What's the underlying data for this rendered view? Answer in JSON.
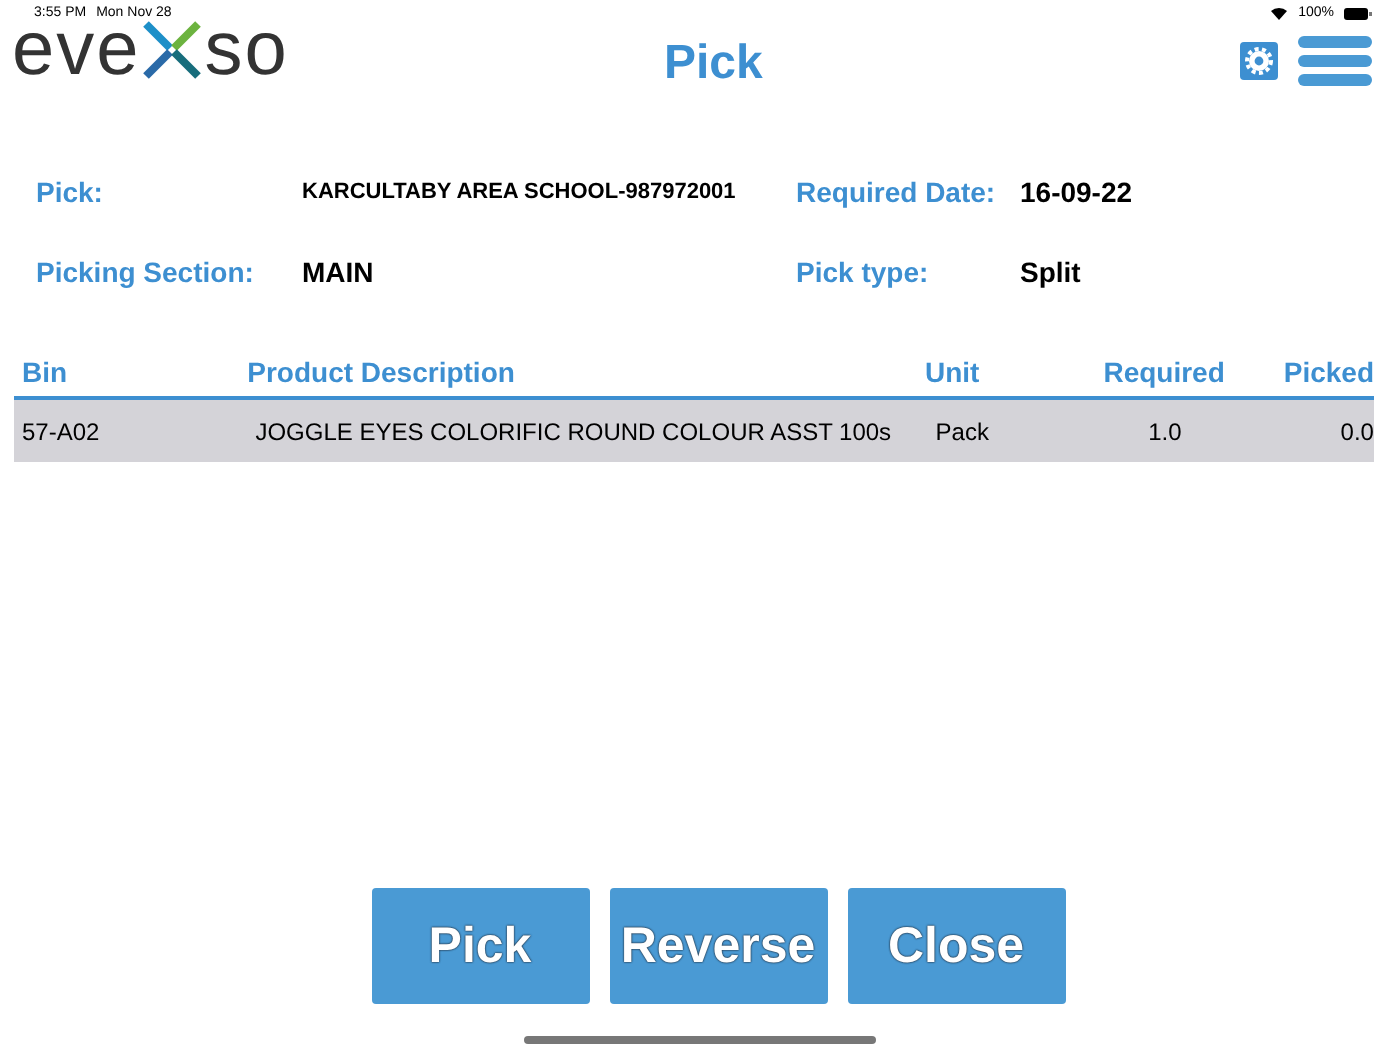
{
  "status_bar": {
    "time": "3:55 PM",
    "date": "Mon Nov 28",
    "battery": "100%"
  },
  "logo": {
    "left": "eve",
    "right": "so"
  },
  "title": "Pick",
  "fields": [
    {
      "label": "Pick:",
      "value": "KARCULTABY AREA SCHOOL-987972001",
      "kind": "small"
    },
    {
      "label": "Required Date:",
      "value": "16-09-22",
      "kind": "large"
    },
    {
      "label": "Picking Section:",
      "value": "MAIN",
      "kind": "large"
    },
    {
      "label": "Pick type:",
      "value": "Split",
      "kind": "large"
    }
  ],
  "table": {
    "columns": [
      "Bin",
      "Product Description",
      "Unit",
      "Required",
      "Picked"
    ],
    "rows": [
      {
        "selected": true,
        "cells": [
          "57-A02",
          "JOGGLE EYES COLORIFIC ROUND COLOUR ASST 100s",
          "Pack",
          "1.0",
          "0.0"
        ]
      }
    ]
  },
  "buttons": [
    "Pick",
    "Reverse",
    "Close"
  ]
}
